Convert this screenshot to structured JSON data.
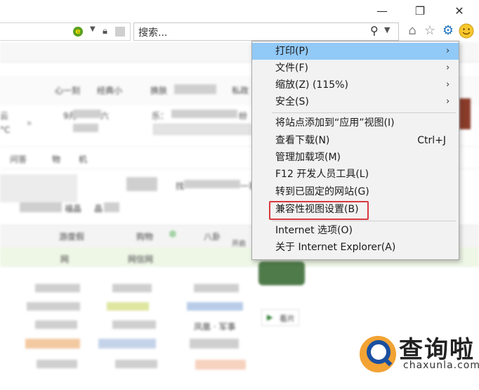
{
  "window": {
    "minimize_glyph": "—",
    "restore_glyph": "❐",
    "close_glyph": "✕"
  },
  "toolbar": {
    "search_placeholder": "搜索...",
    "icons": [
      "home-icon",
      "favorites-star-icon",
      "tools-gear-icon",
      "feedback-smiley-icon"
    ]
  },
  "background_page": {
    "row1": [
      "心一刻",
      "经典小",
      "换肤",
      "私政"
    ],
    "row2": [
      "云",
      "9月",
      "六",
      "乐：",
      "纷"
    ],
    "temp": "°C",
    "row3": [
      "问答",
      "物",
      "机"
    ],
    "row4": [
      "找",
      "一哥"
    ],
    "row5": [
      "福晶",
      "晶"
    ],
    "row6": [
      "游度假",
      "购物",
      "八卦",
      "开启"
    ],
    "row7": [
      "网",
      "网信网"
    ],
    "news": "凤凰 · 军事",
    "video": "看片"
  },
  "menu": {
    "items": [
      {
        "label": "打印(P)",
        "submenu": true,
        "highlighted": true
      },
      {
        "label": "文件(F)",
        "submenu": true
      },
      {
        "label": "缩放(Z) (115%)",
        "submenu": true
      },
      {
        "label": "安全(S)",
        "submenu": true
      },
      {
        "label": "将站点添加到“应用”视图(I)"
      },
      {
        "label": "查看下载(N)",
        "shortcut": "Ctrl+J"
      },
      {
        "label": "管理加载项(M)"
      },
      {
        "label": "F12 开发人员工具(L)"
      },
      {
        "label": "转到已固定的网站(G)"
      },
      {
        "label": "兼容性视图设置(B)",
        "outlined": true
      },
      {
        "label": "Internet 选项(O)"
      },
      {
        "label": "关于 Internet Explorer(A)"
      }
    ]
  },
  "watermark": {
    "title": "查询啦",
    "url": "chaxunla.com"
  },
  "colors": {
    "menu_highlight": "#91c9f7",
    "outline_red": "#d9383f",
    "gear_blue": "#1e73be",
    "watermark_orange": "#f2a334"
  }
}
